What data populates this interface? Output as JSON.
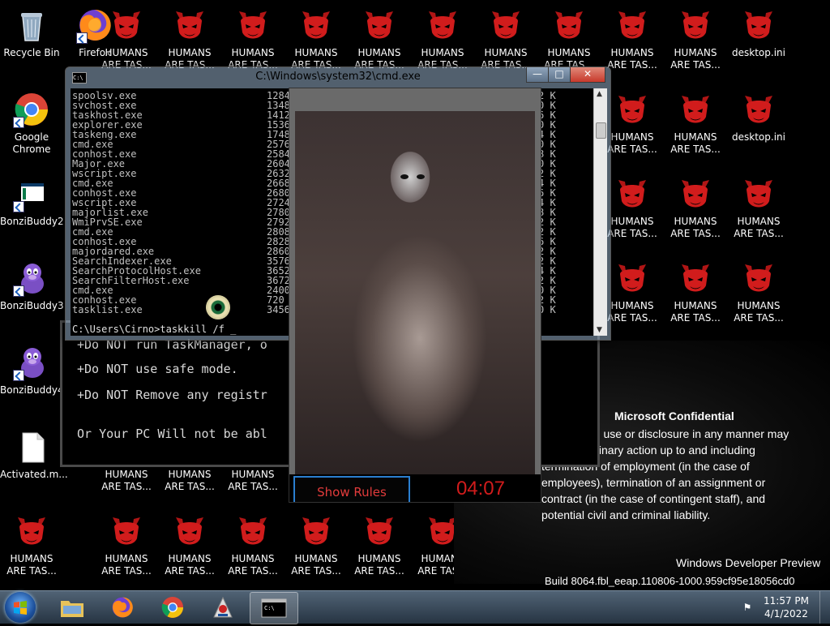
{
  "desktop": {
    "icons": [
      {
        "label": "Recycle Bin"
      },
      {
        "label": "Firefox"
      },
      {
        "label": "Google\nChrome"
      },
      {
        "label": "BonziBuddy2"
      },
      {
        "label": "BonziBuddy3"
      },
      {
        "label": "BonziBuddy4"
      },
      {
        "label": "Activated.m..."
      }
    ],
    "demon_label_full": "HUMANS\nARE TAS...",
    "desktop_ini_label": "desktop.ini"
  },
  "ransom": {
    "line1": "+Do NOT run TaskManager, o",
    "line2": "+Do NOT use safe mode.",
    "line3": "+Do NOT Remove any registr",
    "line4": "Or Your PC Will not be abl"
  },
  "cmd": {
    "title": "C:\\Windows\\system32\\cmd.exe",
    "icon_text": "C:\\",
    "minimize": "—",
    "maximize": "□",
    "close": "✕",
    "processes": [
      {
        "name": "spoolsv.exe",
        "pid": "1284",
        "mem": "2 K"
      },
      {
        "name": "svchost.exe",
        "pid": "1348",
        "mem": "0 K"
      },
      {
        "name": "taskhost.exe",
        "pid": "1412",
        "mem": "6 K"
      },
      {
        "name": "explorer.exe",
        "pid": "1536",
        "mem": "0 K"
      },
      {
        "name": "taskeng.exe",
        "pid": "1748",
        "mem": "4 K"
      },
      {
        "name": "cmd.exe",
        "pid": "2576",
        "mem": "0 K"
      },
      {
        "name": "conhost.exe",
        "pid": "2584",
        "mem": "8 K"
      },
      {
        "name": "Major.exe",
        "pid": "2604",
        "mem": "0 K"
      },
      {
        "name": "wscript.exe",
        "pid": "2632",
        "mem": "2 K"
      },
      {
        "name": "cmd.exe",
        "pid": "2668",
        "mem": "4 K"
      },
      {
        "name": "conhost.exe",
        "pid": "2680",
        "mem": "6 K"
      },
      {
        "name": "wscript.exe",
        "pid": "2724",
        "mem": "4 K"
      },
      {
        "name": "majorlist.exe",
        "pid": "2780",
        "mem": "8 K"
      },
      {
        "name": "WmiPrvSE.exe",
        "pid": "2792",
        "mem": "2 K"
      },
      {
        "name": "cmd.exe",
        "pid": "2808",
        "mem": "2 K"
      },
      {
        "name": "conhost.exe",
        "pid": "2828",
        "mem": "6 K"
      },
      {
        "name": "majordared.exe",
        "pid": "2860",
        "mem": "2 K"
      },
      {
        "name": "SearchIndexer.exe",
        "pid": "3576",
        "mem": "2 K"
      },
      {
        "name": "SearchProtocolHost.exe",
        "pid": "3652",
        "mem": "4 K"
      },
      {
        "name": "SearchFilterHost.exe",
        "pid": "3672",
        "mem": "2 K"
      },
      {
        "name": "cmd.exe",
        "pid": "2400",
        "mem": "0 K"
      },
      {
        "name": "conhost.exe",
        "pid": "720",
        "mem": "2 K"
      },
      {
        "name": "tasklist.exe",
        "pid": "3456",
        "mem": "0 K"
      }
    ],
    "prompt": "C:\\Users\\Cirno>taskkill /f _"
  },
  "photo": {
    "show_rules": "Show Rules",
    "timer": "04:07"
  },
  "confidential": {
    "title": "Microsoft Confidential",
    "line1": "zed use or disclosure in any manner may",
    "line2": "disciplinary action up to and including",
    "line3": "termination of employment (in the case of",
    "line4": "employees), termination of an assignment or",
    "line5": "contract (in the case of contingent staff), and",
    "line6": "potential civil and criminal liability.",
    "watermark1": "Windows Developer Preview",
    "watermark2": "Build 8064.fbl_eeap.110806-1000.959cf95e18056cd0"
  },
  "taskbar": {
    "time": "11:57 PM",
    "date": "4/1/2022",
    "apps": [
      "explorer-icon",
      "firefox-icon",
      "chrome-icon",
      "java-icon",
      "cmd-icon"
    ]
  },
  "colors": {
    "demon": "#cc1a1a",
    "timer": "#d11c1c",
    "show_rules": "#e23b3b",
    "close_button": "#c8392b"
  }
}
